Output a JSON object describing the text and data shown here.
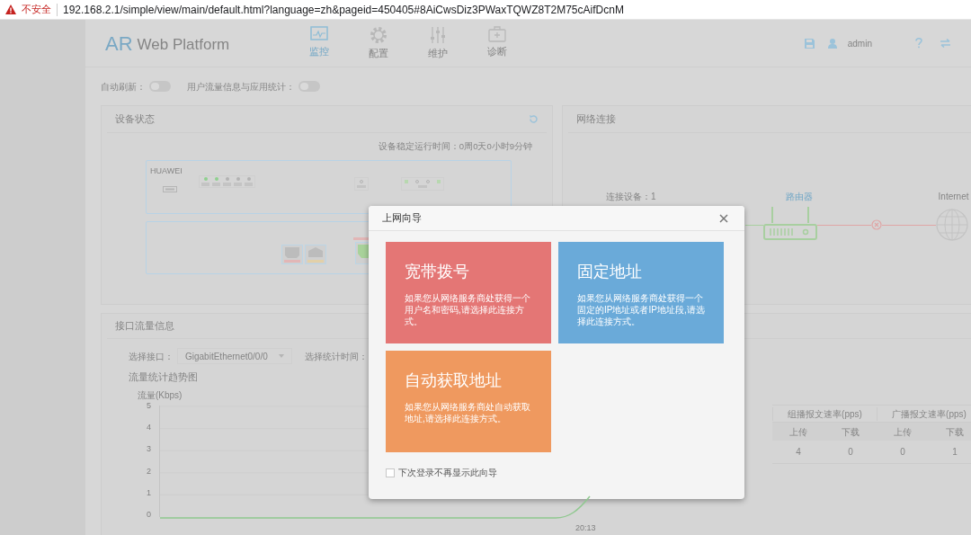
{
  "address_bar": {
    "warning": "不安全",
    "url": "192.168.2.1/simple/view/main/default.html?language=zh&pageid=450405#8AiCwsDiz3PWaxTQWZ8T2M75cAifDcnM"
  },
  "header": {
    "logo_mark": "AR",
    "logo_text": "Web Platform",
    "nav": [
      {
        "label": "监控",
        "kind": "monitor",
        "selected": true
      },
      {
        "label": "配置",
        "kind": "config",
        "selected": false
      },
      {
        "label": "维护",
        "kind": "maintain",
        "selected": false
      },
      {
        "label": "诊断",
        "kind": "diagnose",
        "selected": false
      }
    ],
    "user": "admin"
  },
  "toggles": [
    {
      "label": "自动刷新：",
      "on": false
    },
    {
      "label": "用户流量信息与应用统计：",
      "on": false
    }
  ],
  "device_status": {
    "title": "设备状态",
    "uptime": "设备稳定运行时间：0周0天0小时9分钟",
    "brand": "HUAWEI",
    "leds": [
      {
        "on": true
      },
      {
        "on": true
      },
      {
        "on": false
      },
      {
        "on": false
      },
      {
        "on": false
      }
    ]
  },
  "network": {
    "title": "网络连接",
    "devices": "连接设备：1",
    "router": "路由器",
    "internet": "Internet",
    "connected": false
  },
  "traffic": {
    "title": "接口流量信息",
    "interface_label": "选择接口：",
    "interface": "GigabitEthernet0/0/0",
    "time_label": "选择统计时间：",
    "chart_title": "流量统计趋势图",
    "unit": "流量(Kbps)",
    "yticks": [
      "5",
      "4",
      "3",
      "2",
      "1",
      "0"
    ],
    "x_last": "20:13",
    "table": {
      "groups": [
        "组播报文速率(pps)",
        "广播报文速率(pps)"
      ],
      "sub": [
        "上传",
        "下载",
        "上传",
        "下载"
      ],
      "row": [
        "4",
        "0",
        "0",
        "1"
      ]
    }
  },
  "dialog": {
    "title": "上网向导",
    "options": [
      {
        "title": "宽带拨号",
        "description": "如果您从网络服务商处获得一个用户名和密码,请选择此连接方式。",
        "color": "#e47675"
      },
      {
        "title": "固定地址",
        "description": "如果您从网络服务商处获得一个固定的IP地址或者IP地址段,请选择此连接方式。",
        "color": "#6aaad9"
      },
      {
        "title": "自动获取地址",
        "description": "如果您从网络服务商处自动获取地址,请选择此连接方式。",
        "color": "#ef995f"
      }
    ],
    "dont_show": {
      "label": "下次登录不再显示此向导",
      "checked": false
    }
  }
}
